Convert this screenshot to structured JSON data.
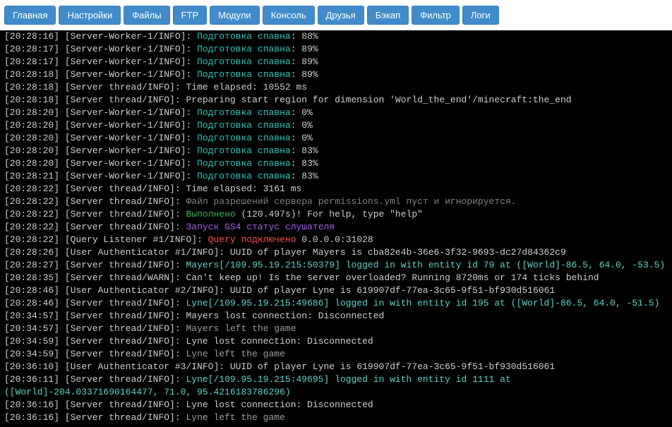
{
  "tabs": [
    {
      "label": "Главная"
    },
    {
      "label": "Настройки"
    },
    {
      "label": "Файлы"
    },
    {
      "label": "FTP"
    },
    {
      "label": "Модули"
    },
    {
      "label": "Консоль"
    },
    {
      "label": "Друзья"
    },
    {
      "label": "Бэкап"
    },
    {
      "label": "Фильтр"
    },
    {
      "label": "Логи"
    }
  ],
  "lines": [
    {
      "ts": "[20:28:16]",
      "src": "[Server-Worker-1/INFO]",
      "segs": [
        {
          "t": "Подготовка спавна",
          "c": "teal"
        },
        {
          "t": ": 88%",
          "c": "txt"
        }
      ]
    },
    {
      "ts": "[20:28:17]",
      "src": "[Server-Worker-1/INFO]",
      "segs": [
        {
          "t": "Подготовка спавна",
          "c": "teal"
        },
        {
          "t": ": 89%",
          "c": "txt"
        }
      ]
    },
    {
      "ts": "[20:28:17]",
      "src": "[Server-Worker-1/INFO]",
      "segs": [
        {
          "t": "Подготовка спавна",
          "c": "teal"
        },
        {
          "t": ": 89%",
          "c": "txt"
        }
      ]
    },
    {
      "ts": "[20:28:18]",
      "src": "[Server-Worker-1/INFO]",
      "segs": [
        {
          "t": "Подготовка спавна",
          "c": "teal"
        },
        {
          "t": ": 89%",
          "c": "txt"
        }
      ]
    },
    {
      "ts": "[20:28:18]",
      "src": "[Server thread/INFO]",
      "segs": [
        {
          "t": "Time elapsed: 10552 ms",
          "c": "txt"
        }
      ]
    },
    {
      "ts": "[20:28:18]",
      "src": "[Server thread/INFO]",
      "segs": [
        {
          "t": "Preparing start region for dimension 'World_the_end'/minecraft:the_end",
          "c": "txt"
        }
      ]
    },
    {
      "ts": "[20:28:20]",
      "src": "[Server-Worker-1/INFO]",
      "segs": [
        {
          "t": "Подготовка спавна",
          "c": "teal"
        },
        {
          "t": ": 0%",
          "c": "txt"
        }
      ]
    },
    {
      "ts": "[20:28:20]",
      "src": "[Server-Worker-1/INFO]",
      "segs": [
        {
          "t": "Подготовка спавна",
          "c": "teal"
        },
        {
          "t": ": 0%",
          "c": "txt"
        }
      ]
    },
    {
      "ts": "[20:28:20]",
      "src": "[Server-Worker-1/INFO]",
      "segs": [
        {
          "t": "Подготовка спавна",
          "c": "teal"
        },
        {
          "t": ": 0%",
          "c": "txt"
        }
      ]
    },
    {
      "ts": "[20:28:20]",
      "src": "[Server-Worker-1/INFO]",
      "segs": [
        {
          "t": "Подготовка спавна",
          "c": "teal"
        },
        {
          "t": ": 83%",
          "c": "txt"
        }
      ]
    },
    {
      "ts": "[20:28:20]",
      "src": "[Server-Worker-1/INFO]",
      "segs": [
        {
          "t": "Подготовка спавна",
          "c": "teal"
        },
        {
          "t": ": 83%",
          "c": "txt"
        }
      ]
    },
    {
      "ts": "[20:28:21]",
      "src": "[Server-Worker-1/INFO]",
      "segs": [
        {
          "t": "Подготовка спавна",
          "c": "teal"
        },
        {
          "t": ": 83%",
          "c": "txt"
        }
      ]
    },
    {
      "ts": "[20:28:22]",
      "src": "[Server thread/INFO]",
      "segs": [
        {
          "t": "Time elapsed: 3161 ms",
          "c": "txt"
        }
      ]
    },
    {
      "ts": "[20:28:22]",
      "src": "[Server thread/INFO]",
      "segs": [
        {
          "t": "Файл разрешений сервера permissions.yml пуст и игнорируется.",
          "c": "gray3"
        }
      ]
    },
    {
      "ts": "[20:28:22]",
      "src": "[Server thread/INFO]",
      "segs": [
        {
          "t": "Выполнено",
          "c": "green"
        },
        {
          "t": " (120.497s)! For help, type \"help\"",
          "c": "txt"
        }
      ]
    },
    {
      "ts": "[20:28:22]",
      "src": "[Server thread/INFO]",
      "segs": [
        {
          "t": "Запуск GS4 статус слушателя",
          "c": "purple"
        }
      ]
    },
    {
      "ts": "[20:28:22]",
      "src": "[Query Listener #1/INFO]",
      "segs": [
        {
          "t": "Query подключено",
          "c": "red"
        },
        {
          "t": " 0.0.0.0:31028",
          "c": "txt"
        }
      ]
    },
    {
      "ts": "[20:28:26]",
      "src": "[User Authenticator #1/INFO]",
      "segs": [
        {
          "t": "UUID of player Mayers is cba82e4b-36e6-3f32-9693-dc27d84362c9",
          "c": "txt"
        }
      ]
    },
    {
      "ts": "[20:28:27]",
      "src": "[Server thread/INFO]",
      "segs": [
        {
          "t": "Mayers[/109.95.19.215:50379] logged in with entity id 79 at ([World]-86.5, 64.0, -53.5)",
          "c": "teal2"
        }
      ]
    },
    {
      "ts": "[20:28:35]",
      "src": "[Server thread/WARN]",
      "segs": [
        {
          "t": "Can't keep up! Is the server overloaded? Running 8720ms or 174 ticks behind",
          "c": "txt"
        }
      ]
    },
    {
      "ts": "[20:28:46]",
      "src": "[User Authenticator #2/INFO]",
      "segs": [
        {
          "t": "UUID of player Lyne is 619907df-77ea-3c65-9f51-bf930d516061",
          "c": "txt"
        }
      ]
    },
    {
      "ts": "[20:28:46]",
      "src": "[Server thread/INFO]",
      "segs": [
        {
          "t": "Lyne[/109.95.19.215:49686] logged in with entity id 195 at ([World]-86.5, 64.0, -51.5)",
          "c": "teal2"
        }
      ]
    },
    {
      "ts": "[20:34:57]",
      "src": "[Server thread/INFO]",
      "segs": [
        {
          "t": "Mayers lost connection: Disconnected",
          "c": "txt"
        }
      ]
    },
    {
      "ts": "[20:34:57]",
      "src": "[Server thread/INFO]",
      "segs": [
        {
          "t": "Mayers left the game",
          "c": "gray2"
        }
      ]
    },
    {
      "ts": "[20:34:59]",
      "src": "[Server thread/INFO]",
      "segs": [
        {
          "t": "Lyne lost connection: Disconnected",
          "c": "txt"
        }
      ]
    },
    {
      "ts": "[20:34:59]",
      "src": "[Server thread/INFO]",
      "segs": [
        {
          "t": "Lyne left the game",
          "c": "gray2"
        }
      ]
    },
    {
      "ts": "[20:36:10]",
      "src": "[User Authenticator #3/INFO]",
      "segs": [
        {
          "t": "UUID of player Lyne is 619907df-77ea-3c65-9f51-bf930d516061",
          "c": "txt"
        }
      ]
    },
    {
      "ts": "[20:36:11]",
      "src": "[Server thread/INFO]",
      "segs": [
        {
          "t": "Lyne[/109.95.19.215:49695] logged in with entity id 1111 at ([World]-204.03371690164477, 71.0, 95.4216183786296)",
          "c": "teal2"
        }
      ]
    },
    {
      "ts": "[20:36:16]",
      "src": "[Server thread/INFO]",
      "segs": [
        {
          "t": "Lyne lost connection: Disconnected",
          "c": "txt"
        }
      ]
    },
    {
      "ts": "[20:36:16]",
      "src": "[Server thread/INFO]",
      "segs": [
        {
          "t": "Lyne left the game",
          "c": "gray2"
        }
      ]
    }
  ]
}
